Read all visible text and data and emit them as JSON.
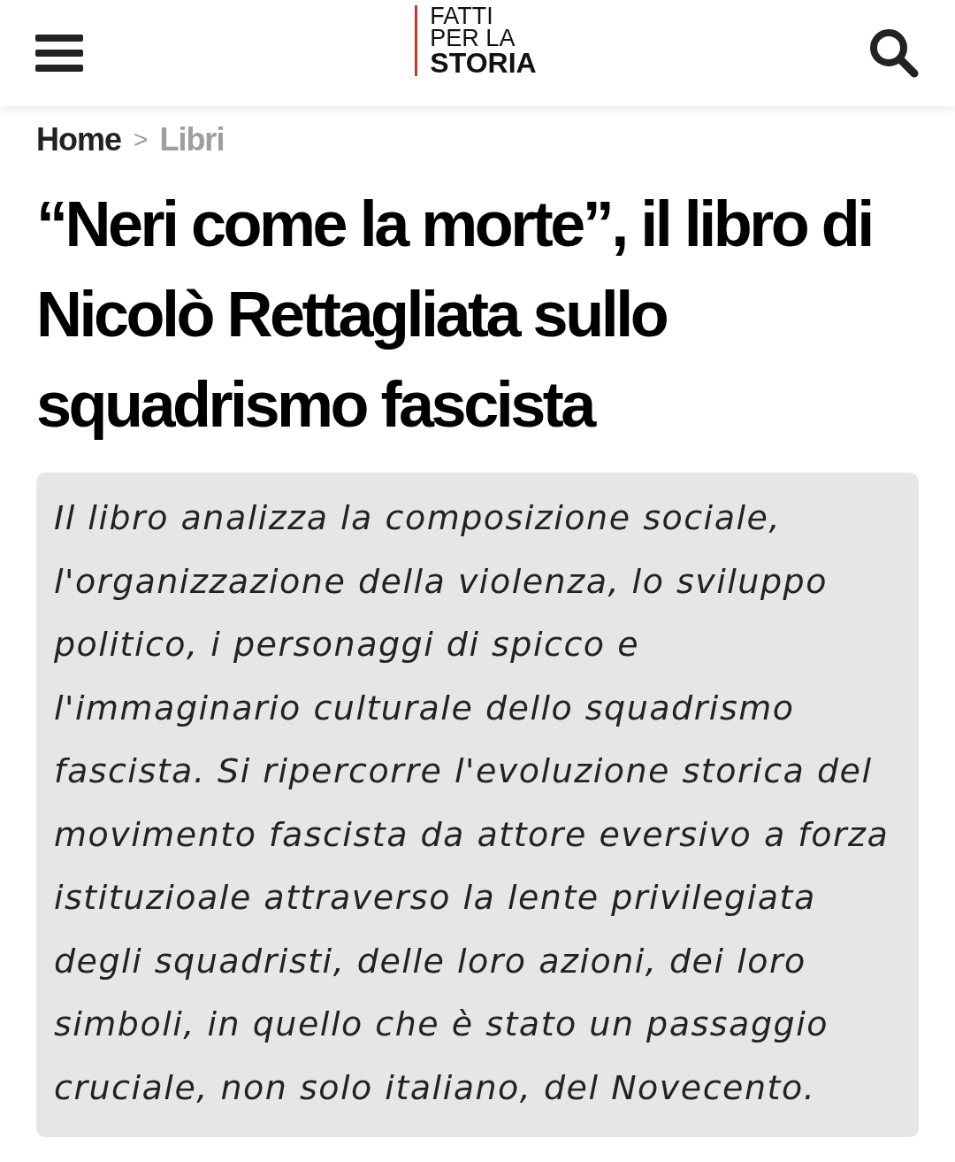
{
  "header": {
    "logo": [
      "FATTI",
      "PER LA",
      "STORIA"
    ]
  },
  "breadcrumb": [
    {
      "label": "Home",
      "selected": false
    },
    {
      "label": "Libri",
      "selected": true
    }
  ],
  "breadcrumb_separator": ">",
  "title": "“Neri come la morte”, il libro di Nicolò Rettagliata sullo squadrismo fascista",
  "summary": "Il libro analizza la composizione sociale, l'organizzazione della violenza, lo sviluppo politico, i personaggi di spicco e l'immaginario culturale dello squadrismo fascista. Si ripercorre l'evoluzione storica del movimento fascista da attore eversivo a forza istituzioale attraverso la lente privilegiata degli squadristi, delle loro azioni, dei loro simboli, in quello che è stato un passaggio cruciale, non solo italiano, del Novecento."
}
